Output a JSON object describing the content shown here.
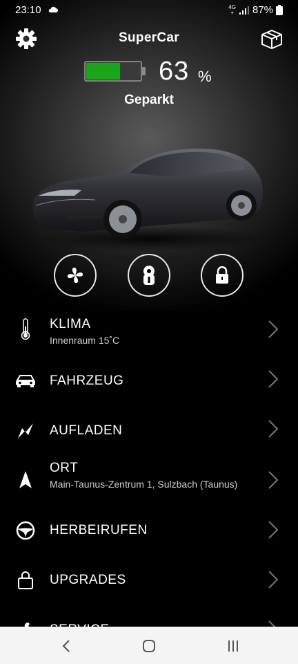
{
  "status_bar": {
    "time": "23:10",
    "network_top": "4G",
    "network_bottom": "+",
    "battery": "87%"
  },
  "header": {
    "title": "SuperCar",
    "settings_icon": "gear-icon",
    "box_icon": "box-icon"
  },
  "battery": {
    "level": 63,
    "percent_value": "63",
    "percent_sign": "%",
    "fill_color": "#1aa51a"
  },
  "vehicle_status": "Geparkt",
  "quick_actions": [
    {
      "name": "fan-icon"
    },
    {
      "name": "key-icon"
    },
    {
      "name": "lock-icon"
    }
  ],
  "menu": {
    "items": [
      {
        "title": "KLIMA",
        "subtitle": "Innenraum 15˚C",
        "icon": "thermometer-icon"
      },
      {
        "title": "FAHRZEUG",
        "subtitle": "",
        "icon": "car-icon"
      },
      {
        "title": "AUFLADEN",
        "subtitle": "",
        "icon": "lightning-icon"
      },
      {
        "title": "ORT",
        "subtitle": "Main-Taunus-Zentrum 1, Sulzbach (Taunus)",
        "icon": "navigation-arrow-icon"
      },
      {
        "title": "HERBEIRUFEN",
        "subtitle": "",
        "icon": "steering-wheel-icon"
      },
      {
        "title": "UPGRADES",
        "subtitle": "",
        "icon": "bag-icon"
      },
      {
        "title": "SERVICE",
        "subtitle": "",
        "icon": "wrench-icon"
      }
    ]
  }
}
